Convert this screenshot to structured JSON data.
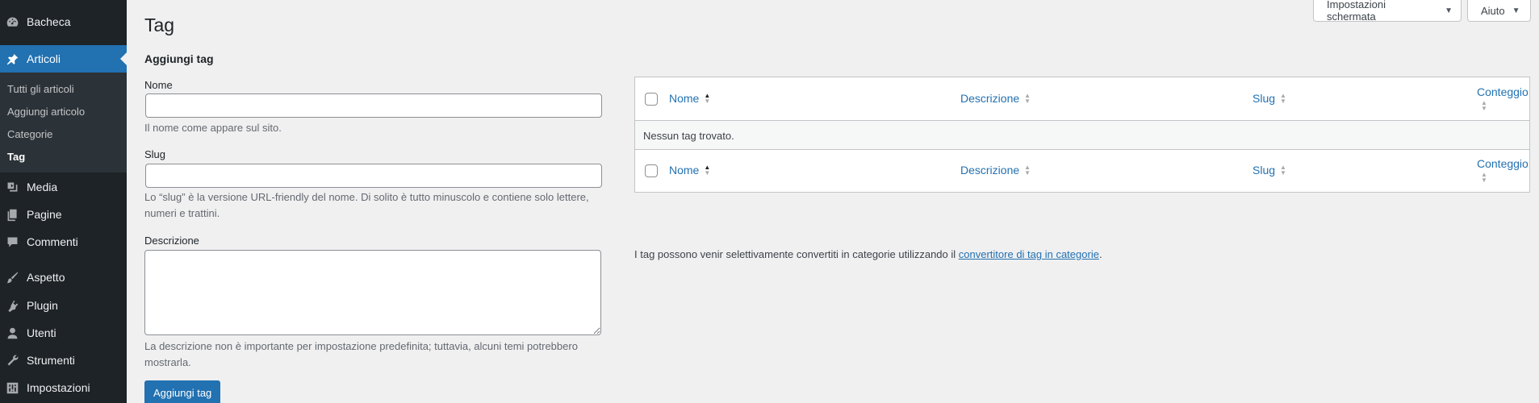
{
  "sidebar": {
    "items": [
      {
        "label": "Bacheca",
        "icon": "dashboard-icon"
      },
      {
        "label": "Articoli",
        "icon": "pin-icon",
        "active": true
      },
      {
        "label": "Media",
        "icon": "media-icon"
      },
      {
        "label": "Pagine",
        "icon": "pages-icon"
      },
      {
        "label": "Commenti",
        "icon": "comments-icon"
      },
      {
        "label": "Aspetto",
        "icon": "brush-icon"
      },
      {
        "label": "Plugin",
        "icon": "plugin-icon"
      },
      {
        "label": "Utenti",
        "icon": "users-icon"
      },
      {
        "label": "Strumenti",
        "icon": "wrench-icon"
      },
      {
        "label": "Impostazioni",
        "icon": "settings-icon"
      }
    ],
    "submenu": [
      "Tutti gli articoli",
      "Aggiungi articolo",
      "Categorie",
      "Tag"
    ]
  },
  "topbar": {
    "screen_options": "Impostazioni schermata",
    "help": "Aiuto"
  },
  "page": {
    "title": "Tag",
    "form_title": "Aggiungi tag"
  },
  "form": {
    "name_label": "Nome",
    "name_help": "Il nome come appare sul sito.",
    "slug_label": "Slug",
    "slug_help": "Lo “slug” è la versione URL-friendly del nome. Di solito è tutto minuscolo e contiene solo lettere, numeri e trattini.",
    "desc_label": "Descrizione",
    "desc_help": "La descrizione non è importante per impostazione predefinita; tuttavia, alcuni temi potrebbero mostrarla.",
    "submit": "Aggiungi tag"
  },
  "table": {
    "columns": [
      "Nome",
      "Descrizione",
      "Slug",
      "Conteggio"
    ],
    "empty": "Nessun tag trovato."
  },
  "note": {
    "text": "I tag possono venir selettivamente convertiti in categorie utilizzando il ",
    "link": "convertitore di tag in categorie",
    "end": "."
  },
  "colors": {
    "sidebar_bg": "#1d2327",
    "submenu_bg": "#2c3338",
    "accent": "#2271b1",
    "page_bg": "#f0f0f1"
  }
}
